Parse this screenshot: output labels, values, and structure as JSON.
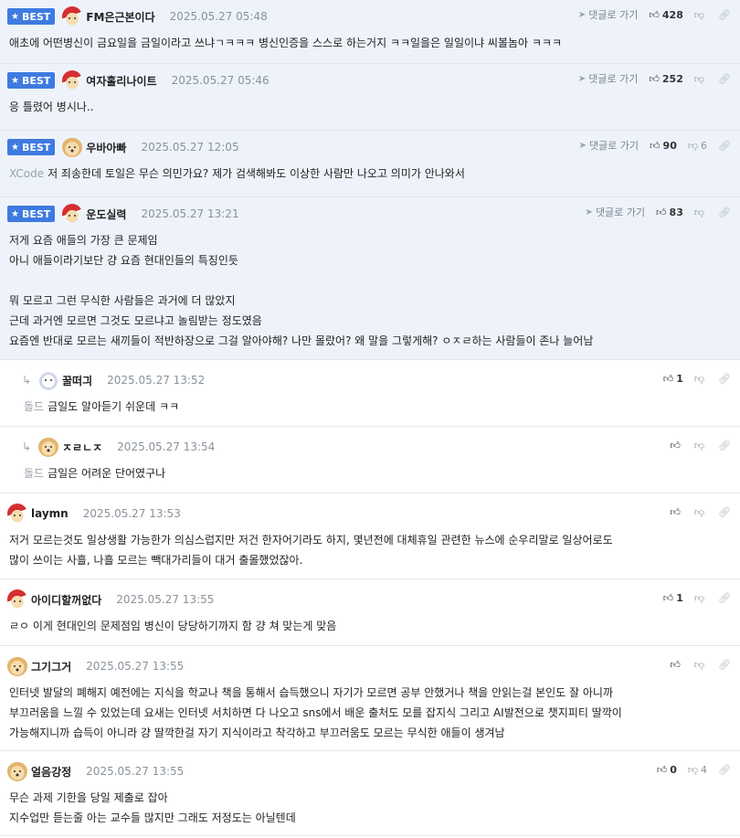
{
  "labels": {
    "best": "BEST",
    "goto": "댓글로 가기"
  },
  "comments": [
    {
      "id": "c1",
      "best": true,
      "avatar": "santa",
      "nick": "FM은근본이다",
      "date": "2025.05.27 05:48",
      "up": "428",
      "down": "",
      "lines": [
        "애초에 어떤병신이 금요일을 금일이라고 쓰냐ㄱㅋㅋㅋ 병신인증을 스스로 하는거지 ㅋㅋ일을은 일일이냐 씨볼놈아 ㅋㅋㅋ"
      ]
    },
    {
      "id": "c2",
      "best": true,
      "avatar": "santa",
      "nick": "여자홀리나이트",
      "date": "2025.05.27 05:46",
      "up": "252",
      "down": "",
      "lines": [
        "응 틀렸어 병시나.."
      ]
    },
    {
      "id": "c3",
      "best": true,
      "avatar": "dog",
      "nick": "우바아빠",
      "date": "2025.05.27 12:05",
      "up": "90",
      "down": "6",
      "ref": "XCode",
      "lines": [
        "저 죄송한데 토일은 무슨 의민가요? 제가 검색해봐도 이상한 사람만 나오고 의미가 안나와서"
      ]
    },
    {
      "id": "c4",
      "best": true,
      "avatar": "santa",
      "nick": "운도실력",
      "date": "2025.05.27 13:21",
      "up": "83",
      "down": "",
      "lines": [
        "저게 요즘 애들의 가장 큰 문제임",
        "아니 애들이라기보단 걍 요즘 현대인들의 특징인듯",
        "",
        "뭐 모르고 그런 무식한 사람들은 과거에 더 많았지",
        "근데 과거엔 모르면 그것도 모르냐고 놀림받는 정도였음",
        "요즘엔 반대로 모르는 새끼들이 적반하장으로 그걸 알아야해? 나만 몰랐어? 왜 말을 그렇게해? ㅇㅈㄹ하는 사람들이 존나 늘어남"
      ]
    },
    {
      "id": "r1",
      "reply": true,
      "avatar": "bear",
      "nick": "꿀떠긔",
      "date": "2025.05.27 13:52",
      "up": "1",
      "down": "",
      "ref": "돌드",
      "lines": [
        "금일도 알아듣기 쉬운데 ㅋㅋ"
      ]
    },
    {
      "id": "r2",
      "reply": true,
      "avatar": "dog",
      "nick": "ㅈㄹㄴㅈ",
      "date": "2025.05.27 13:54",
      "up": "",
      "down": "",
      "ref": "돌드",
      "lines": [
        "금일은 어려운 단어였구나"
      ]
    },
    {
      "id": "c5",
      "avatar": "santa",
      "nick": "laymn",
      "date": "2025.05.27 13:53",
      "up": "",
      "down": "",
      "lines": [
        "저거 모르는것도 일상생활 가능한가 의심스럽지만 저건 한자어기라도 하지, 몇년전에 대체휴일 관련한 뉴스에 순우리말로 일상어로도",
        "많이 쓰이는 사흘, 나흘 모르는 빽대가리들이 대거 출몰했었잖아."
      ]
    },
    {
      "id": "c6",
      "avatar": "santa",
      "nick": "아이디할꺼없다",
      "date": "2025.05.27 13:55",
      "up": "1",
      "down": "",
      "lines": [
        "ㄹㅇ 이게 현대인의 문제점임 병신이 당당하기까지 함 걍 쳐 맞는게 맞음"
      ]
    },
    {
      "id": "c7",
      "avatar": "dog",
      "nick": "그기그거",
      "date": "2025.05.27 13:55",
      "up": "",
      "down": "",
      "lines": [
        "인터넷 발달의 폐해지 예전에는 지식을 학교나 책을 통해서 습득했으니 자기가 모르면 공부 안했거나 책을 안읽는걸 본인도 잘 아니까",
        "부끄러움을 느낄 수 있었는데 요새는 인터넷 서치하면 다 나오고 sns에서 배운 출처도 모를 잡지식 그리고 AI발전으로 챗지피티 딸깍이",
        "가능해지니까 습득이 아니라 걍 딸깍한걸 자기 지식이라고 착각하고 부끄러움도 모르는 무식한 애들이 생겨남"
      ]
    },
    {
      "id": "c8",
      "avatar": "dog",
      "nick": "얼음강정",
      "date": "2025.05.27 13:55",
      "up": "0",
      "down": "4",
      "lines": [
        "무슨 과제 기한을 당일 제출로 잡아",
        "지수업만 듣는줄 아는 교수들 많지만 그래도 저정도는 아닐텐데"
      ]
    }
  ]
}
